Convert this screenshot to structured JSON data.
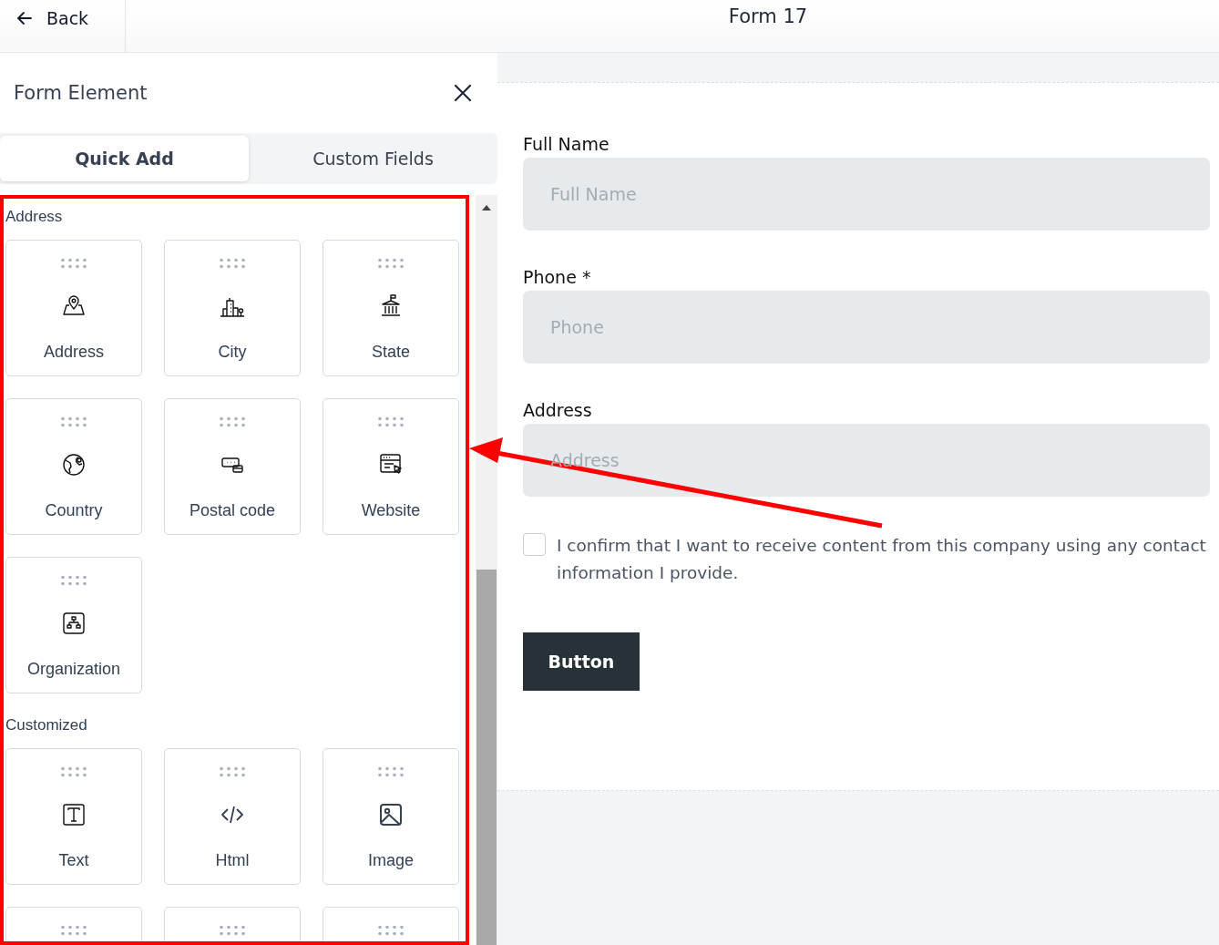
{
  "header": {
    "back_label": "Back",
    "title": "Form 17"
  },
  "panel": {
    "title": "Form Element",
    "tabs": [
      {
        "label": "Quick Add",
        "selected": true
      },
      {
        "label": "Custom Fields",
        "selected": false
      }
    ],
    "sections": [
      {
        "title": "Address",
        "items": [
          {
            "kind": "tile",
            "label": "Address"
          },
          {
            "kind": "tile",
            "label": "City"
          },
          {
            "kind": "tile",
            "label": "State"
          },
          {
            "kind": "tile",
            "label": "Country"
          },
          {
            "kind": "tile",
            "label": "Postal code"
          },
          {
            "kind": "tile",
            "label": "Website"
          },
          {
            "kind": "tile",
            "label": "Organization"
          }
        ]
      },
      {
        "title": "Customized",
        "items": [
          {
            "kind": "tile",
            "label": "Text"
          },
          {
            "kind": "tile",
            "label": "Html"
          },
          {
            "kind": "tile",
            "label": "Image"
          },
          {
            "kind": "cut"
          },
          {
            "kind": "cut"
          },
          {
            "kind": "cut"
          }
        ]
      }
    ]
  },
  "form": {
    "fields": [
      {
        "label": "Full Name",
        "placeholder": "Full Name"
      },
      {
        "label": "Phone *",
        "placeholder": "Phone"
      },
      {
        "label": "Address",
        "placeholder": "Address"
      }
    ],
    "consent": {
      "checked": false,
      "text": "I confirm that I want to receive content from this company using any contact information I provide."
    },
    "button": "Button"
  }
}
